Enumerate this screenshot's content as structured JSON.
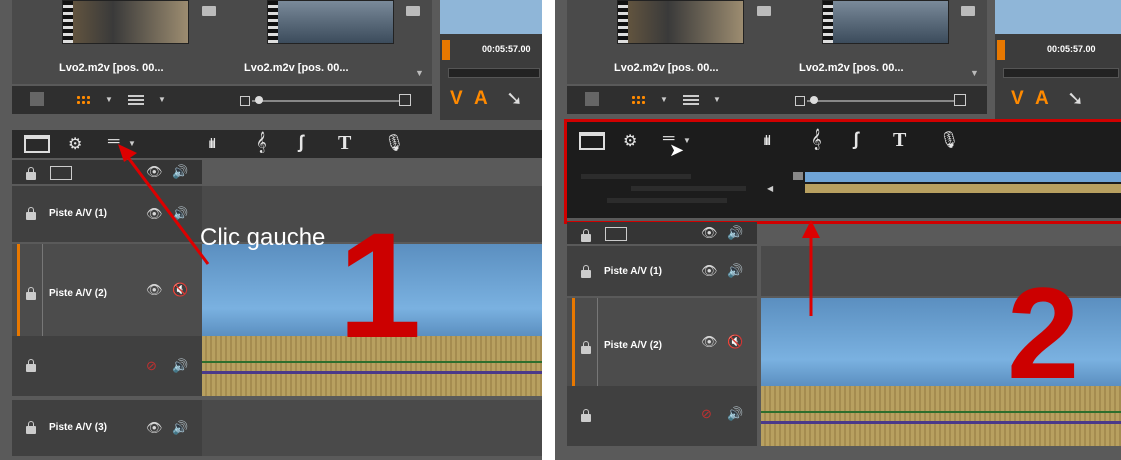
{
  "left_panel": {
    "clips": [
      "Lvo2.m2v [pos. 00...",
      "Lvo2.m2v [pos. 00..."
    ],
    "timecode": "00:05:57.00",
    "buttons": {
      "v": "V",
      "a": "A"
    },
    "tracks": [
      {
        "label": "Piste A/V (1)"
      },
      {
        "label": "Piste A/V (2)"
      },
      {
        "label": "Piste A/V (3)"
      }
    ],
    "annotation_text": "Clic gauche",
    "step_number": "1"
  },
  "right_panel": {
    "clips": [
      "Lvo2.m2v [pos. 00...",
      "Lvo2.m2v [pos. 00..."
    ],
    "timecode": "00:05:57.00",
    "buttons": {
      "v": "V",
      "a": "A"
    },
    "tracks": [
      {
        "label": "Piste A/V (1)"
      },
      {
        "label": "Piste A/V (2)"
      }
    ],
    "step_number": "2"
  },
  "icons": {
    "toolbar": [
      "monitor-icon",
      "settings-gear-icon",
      "track-options-icon",
      "audio-levels-icon",
      "music-clef-icon",
      "transition-icon",
      "title-text-icon",
      "microphone-icon"
    ],
    "track": [
      "lock-icon",
      "film-icon",
      "eye-icon",
      "speaker-icon",
      "speaker-muted-icon",
      "eye-hidden-icon"
    ]
  },
  "colors": {
    "annotation_red": "#cc0000",
    "accent_orange": "#e87800",
    "video_blue": "#6fa4d6",
    "audio_tan": "#b8a060"
  }
}
